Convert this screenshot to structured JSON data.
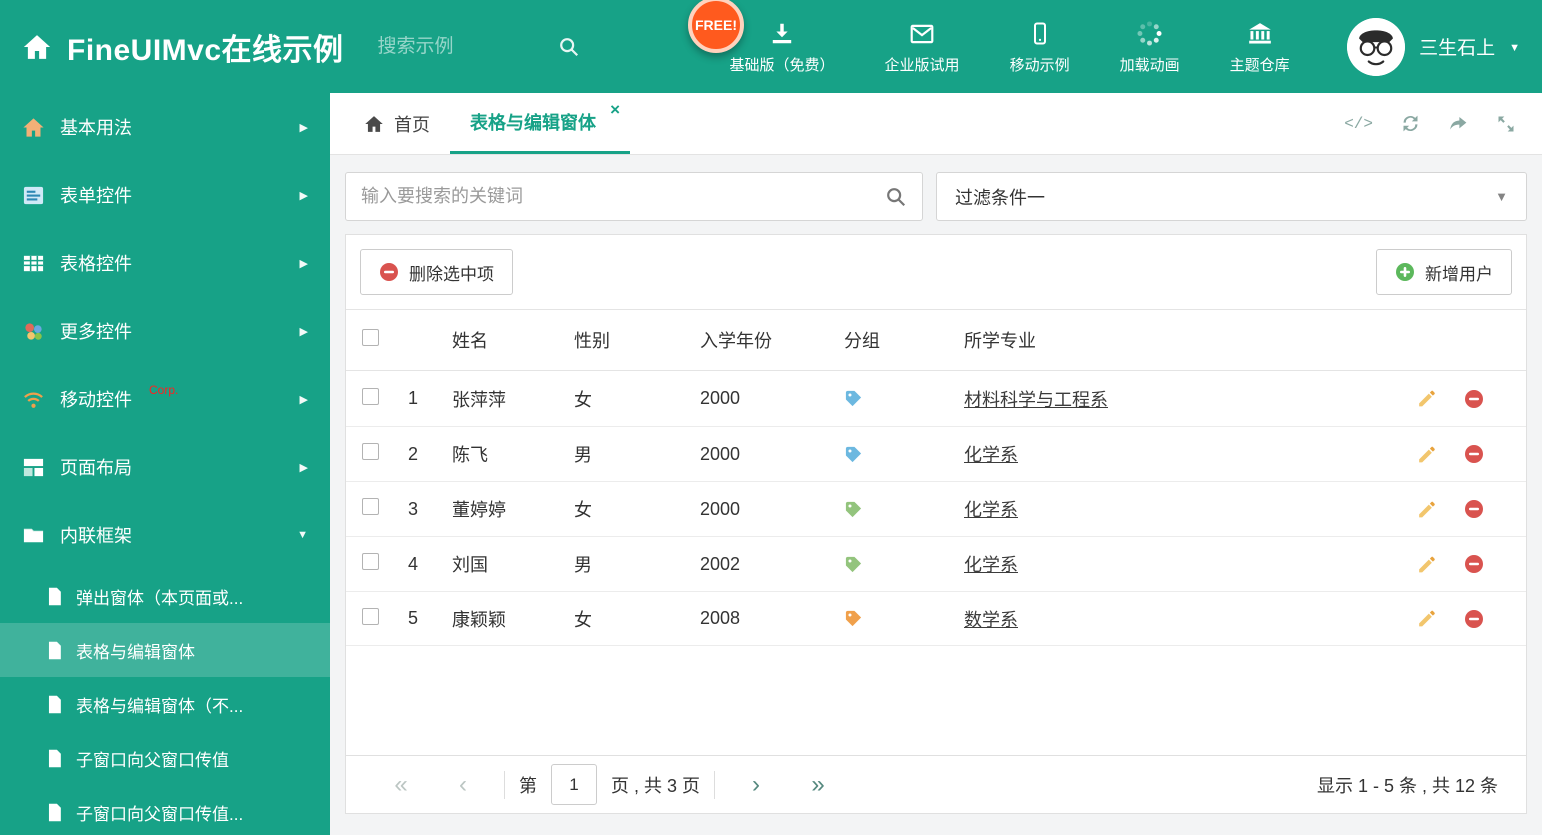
{
  "colors": {
    "accent": "#17a287",
    "free_badge": "#ff5a1e",
    "delete_red": "#d9534f",
    "add_green": "#5cb85c",
    "pencil_orange": "#e8a33d"
  },
  "icons": {
    "close": "×",
    "caret_down": "▼",
    "chevron_right": "▶",
    "chevron_down": "▼",
    "code": "</>",
    "pager_first": "«",
    "pager_prev": "‹",
    "pager_next": "›",
    "pager_last": "»"
  },
  "header": {
    "title": "FineUIMvc在线示例",
    "search_placeholder": "搜索示例",
    "free_badge": "FREE!",
    "nav": [
      {
        "label": "基础版（免费）"
      },
      {
        "label": "企业版试用"
      },
      {
        "label": "移动示例"
      },
      {
        "label": "加载动画"
      },
      {
        "label": "主题仓库"
      }
    ],
    "user_name": "三生石上"
  },
  "sidebar": {
    "items": [
      {
        "label": "基本用法"
      },
      {
        "label": "表单控件"
      },
      {
        "label": "表格控件"
      },
      {
        "label": "更多控件"
      },
      {
        "label": "移动控件",
        "badge": "Corp."
      },
      {
        "label": "页面布局"
      },
      {
        "label": "内联框架"
      }
    ],
    "children": [
      {
        "label": "弹出窗体（本页面或..."
      },
      {
        "label": "表格与编辑窗体"
      },
      {
        "label": "表格与编辑窗体（不..."
      },
      {
        "label": "子窗口向父窗口传值"
      },
      {
        "label": "子窗口向父窗口传值..."
      }
    ]
  },
  "tabs": {
    "home": "首页",
    "active": "表格与编辑窗体"
  },
  "filters": {
    "search_placeholder": "输入要搜索的关键词",
    "filter_value": "过滤条件一"
  },
  "toolbar": {
    "delete_label": "删除选中项",
    "add_label": "新增用户"
  },
  "table": {
    "columns": {
      "name": "姓名",
      "gender": "性别",
      "year": "入学年份",
      "group": "分组",
      "major": "所学专业"
    },
    "rows": [
      {
        "num": "1",
        "name": "张萍萍",
        "gender": "女",
        "year": "2000",
        "tag_color": "#6cb8e0",
        "major": "材料科学与工程系"
      },
      {
        "num": "2",
        "name": "陈飞",
        "gender": "男",
        "year": "2000",
        "tag_color": "#6cb8e0",
        "major": "化学系"
      },
      {
        "num": "3",
        "name": "董婷婷",
        "gender": "女",
        "year": "2000",
        "tag_color": "#93c47d",
        "major": "化学系"
      },
      {
        "num": "4",
        "name": "刘国",
        "gender": "男",
        "year": "2002",
        "tag_color": "#93c47d",
        "major": "化学系"
      },
      {
        "num": "5",
        "name": "康颖颖",
        "gender": "女",
        "year": "2008",
        "tag_color": "#f0a04b",
        "major": "数学系"
      }
    ]
  },
  "pagination": {
    "page_label_before": "第",
    "page_value": "1",
    "page_label_after": "页 , 共 3 页",
    "summary": "显示 1 - 5 条 , 共 12 条"
  }
}
